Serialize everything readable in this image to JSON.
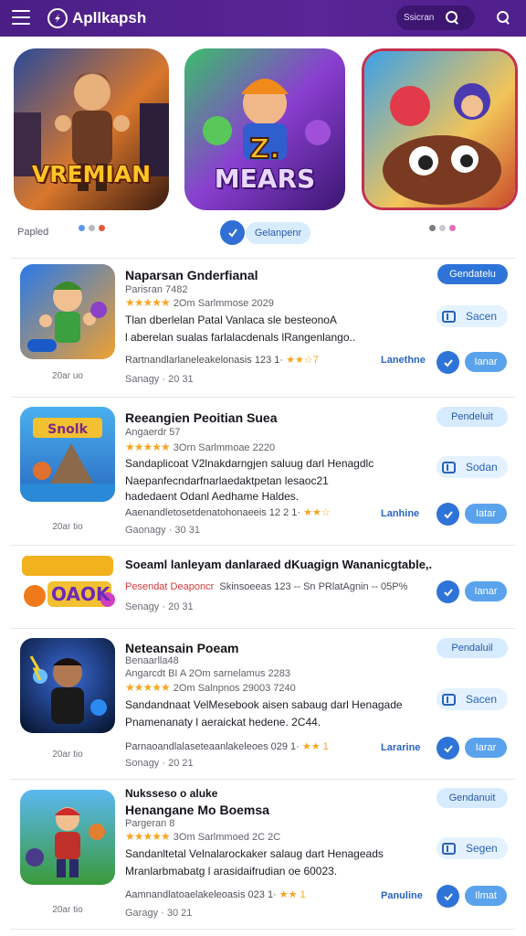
{
  "app": {
    "title": "Apllkapsh",
    "brand_color": "#4f1f8c",
    "accent": "#2e73d8"
  },
  "header": {
    "search_placeholder": "Ssicran",
    "menu_icon": "hamburger-icon",
    "search_icon": "search-icon"
  },
  "carousel": {
    "banners": [
      {
        "text": "VREMIAN"
      },
      {
        "text": "MEARS"
      },
      {
        "text": ""
      }
    ],
    "label": "Papled",
    "pill_label": "Gelanpenr"
  },
  "items": [
    {
      "title": "Naparsan Gnderfianal",
      "subtitle": "Parisran 7482",
      "rating_text": "2Om Sarlmmose 2029",
      "desc1": "Tlan dberlelan Patal Vanlaca sle besteonoA",
      "desc2": "l aberelan sualas farlalacdenals lRangenlango..",
      "meta": "Rartnandlarlaneleakelonasis 123 1·",
      "meta_stars": "★★☆7",
      "date": "Sanagy · 20 31",
      "caption": "20ar uo",
      "btn_top": "Gendatelu",
      "btn_install": "Sacen",
      "link": "Lanethne",
      "small_btn": "Ianar"
    },
    {
      "title": "Reeangien Peoitian Suea",
      "subtitle": "Angaerdr 57",
      "rating_text": "3Orn Sarlmmoae 2220",
      "desc1": "Sandaplicoat V2lnakdarngjen saluug darl Henagdlc",
      "desc2": "Naepanfecndarfnarlaedaktpetan lesaoc21",
      "desc3": "hadedaent Odanl Aedhame Haldes.",
      "meta": "Aaenandletosetdenatohonaeeis 12 2 1·",
      "meta_stars": "★★☆",
      "date": "Gaonagy · 30 31",
      "caption": "20ar tio",
      "btn_top": "Pendeluit",
      "btn_install": "Sodan",
      "link": "Lanhine",
      "small_btn": "Iatar"
    },
    {
      "title": "Soeaml lanleyam danlaraed dKuagign Wananicgtable,.",
      "red_text": "Pesendat Deaponcr",
      "meta_rest": "Skinsoeeas 123 -- Sn PRlatAgnin -- 05P%",
      "date": "Senagy · 20 31",
      "small_btn": "Ianar",
      "logo_text": "OAOK"
    },
    {
      "title": "Neteansain Poeam",
      "subtitle": "Benaarlla48",
      "subtitle2": "Angarcdt BI A 2Om sarnelamus 2283",
      "rating_text": "2Om Salnpnos 29003 7240",
      "desc1": "Sandandnaat VelMesebook aisen sabaug darl Henagade",
      "desc2": "Pnamenanaty l aeraickat hedene. 2C44.",
      "meta": "Parnaoandlalaseteaanlakeleoes 029 1·",
      "meta_stars": "★★ 1",
      "date": "Sonagy · 20 21",
      "caption": "20ar tio",
      "btn_top": "Pendaluil",
      "btn_install": "Sacen",
      "link": "Lararine",
      "small_btn": "Iarar"
    },
    {
      "title": "Nuksseso o aluke",
      "title2": "Henangane Mo Boemsa",
      "subtitle": "Pargeran 8",
      "rating_text": "3Om Sarlmmoed 2C 2C",
      "desc1": "Sandanltetal Velnalarockaker salaug dart Henageads",
      "desc2": "Mranlarbmabatg l arasidaifrudian oe 60023.",
      "meta": "Aamnandlatoaelakeleoasis 023 1·",
      "meta_stars": "★★ 1",
      "date": "Garagy · 30 21",
      "caption": "20ar tio",
      "btn_top": "Gendanuit",
      "btn_install": "Segen",
      "link": "Panuline",
      "small_btn": "Ilmat"
    }
  ]
}
